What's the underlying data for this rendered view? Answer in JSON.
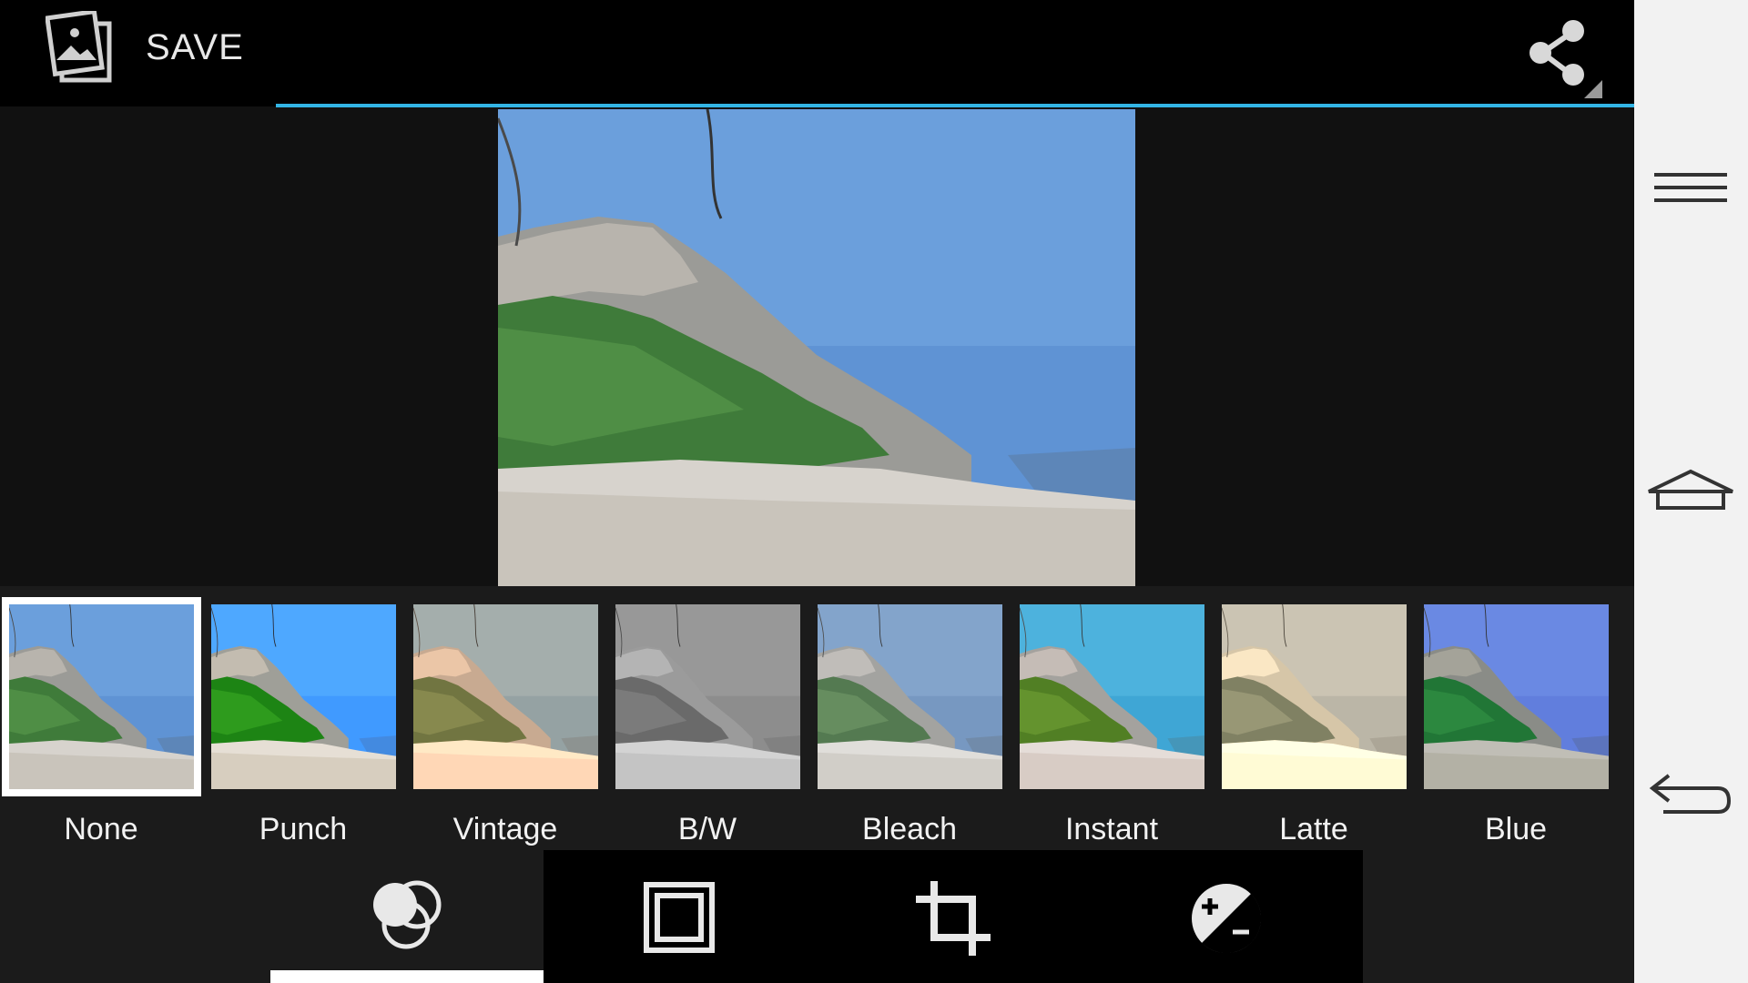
{
  "actionbar": {
    "save_label": "SAVE",
    "icons": [
      "photo-editor-app-icon",
      "share-icon"
    ],
    "accent_color": "#33b5e5"
  },
  "filters": [
    {
      "label": "None",
      "selected": true
    },
    {
      "label": "Punch",
      "selected": false
    },
    {
      "label": "Vintage",
      "selected": false
    },
    {
      "label": "B/W",
      "selected": false
    },
    {
      "label": "Bleach",
      "selected": false
    },
    {
      "label": "Instant",
      "selected": false
    },
    {
      "label": "Latte",
      "selected": false
    },
    {
      "label": "Blue",
      "selected": false
    }
  ],
  "tools": [
    {
      "icon": "filters-icon",
      "active": true
    },
    {
      "icon": "border-frame-icon",
      "active": false
    },
    {
      "icon": "crop-icon",
      "active": false
    },
    {
      "icon": "exposure-icon",
      "active": false
    }
  ],
  "navbar": {
    "icons": [
      "menu-icon",
      "home-icon",
      "back-icon"
    ]
  }
}
